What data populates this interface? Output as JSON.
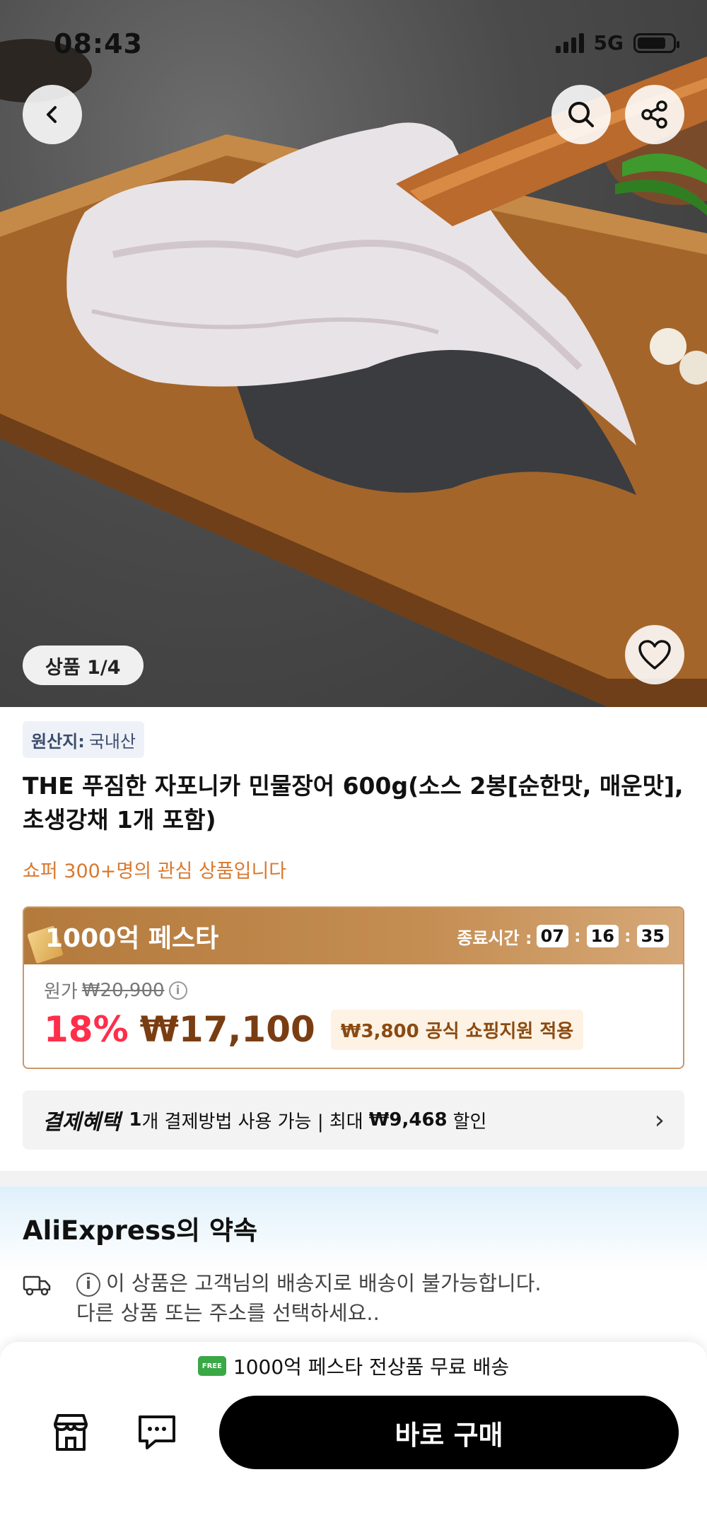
{
  "status": {
    "time": "08:43",
    "network": "5G",
    "battery_level": 0.82
  },
  "hero": {
    "counter": "상품 1/4"
  },
  "product": {
    "origin_label": "원산지:",
    "origin_value": "국내산",
    "title": "THE 푸짐한 자포니카 민물장어 600g(소스 2봉[순한맛, 매운맛], 초생강채 1개 포함)",
    "interest": "쇼퍼 300+명의 관심 상품입니다"
  },
  "festa": {
    "title": "1000억 페스타",
    "timer_label": "종료시간 :",
    "hours": "07",
    "minutes": "16",
    "seconds": "35",
    "original_label": "원가",
    "original_price": "₩20,900",
    "discount": "18%",
    "price": "₩17,100",
    "subsidy": "₩3,800 공식 쇼핑지원 적용"
  },
  "payment": {
    "label": "결제혜택",
    "count": "1",
    "text_mid": "개 결제방법 사용 가능 | 최대",
    "max_amount": "₩9,468",
    "text_end": "할인"
  },
  "promise": {
    "title": "AliExpress의 약속",
    "notice_line1": "이 상품은 고객님의 배송지로 배송이 불가능합니다.",
    "notice_line2": "다른 상품 또는 주소를 선택하세요.."
  },
  "bottom": {
    "free_shipping": "1000억 페스타 전상품 무료 배송",
    "free_icon_text": "FREE",
    "buy_label": "바로 구매"
  },
  "colors": {
    "accent_red": "#ff2e4b",
    "price_brown": "#7a3d12",
    "festa_gold": "#b37a3c",
    "interest_orange": "#d9792e"
  }
}
